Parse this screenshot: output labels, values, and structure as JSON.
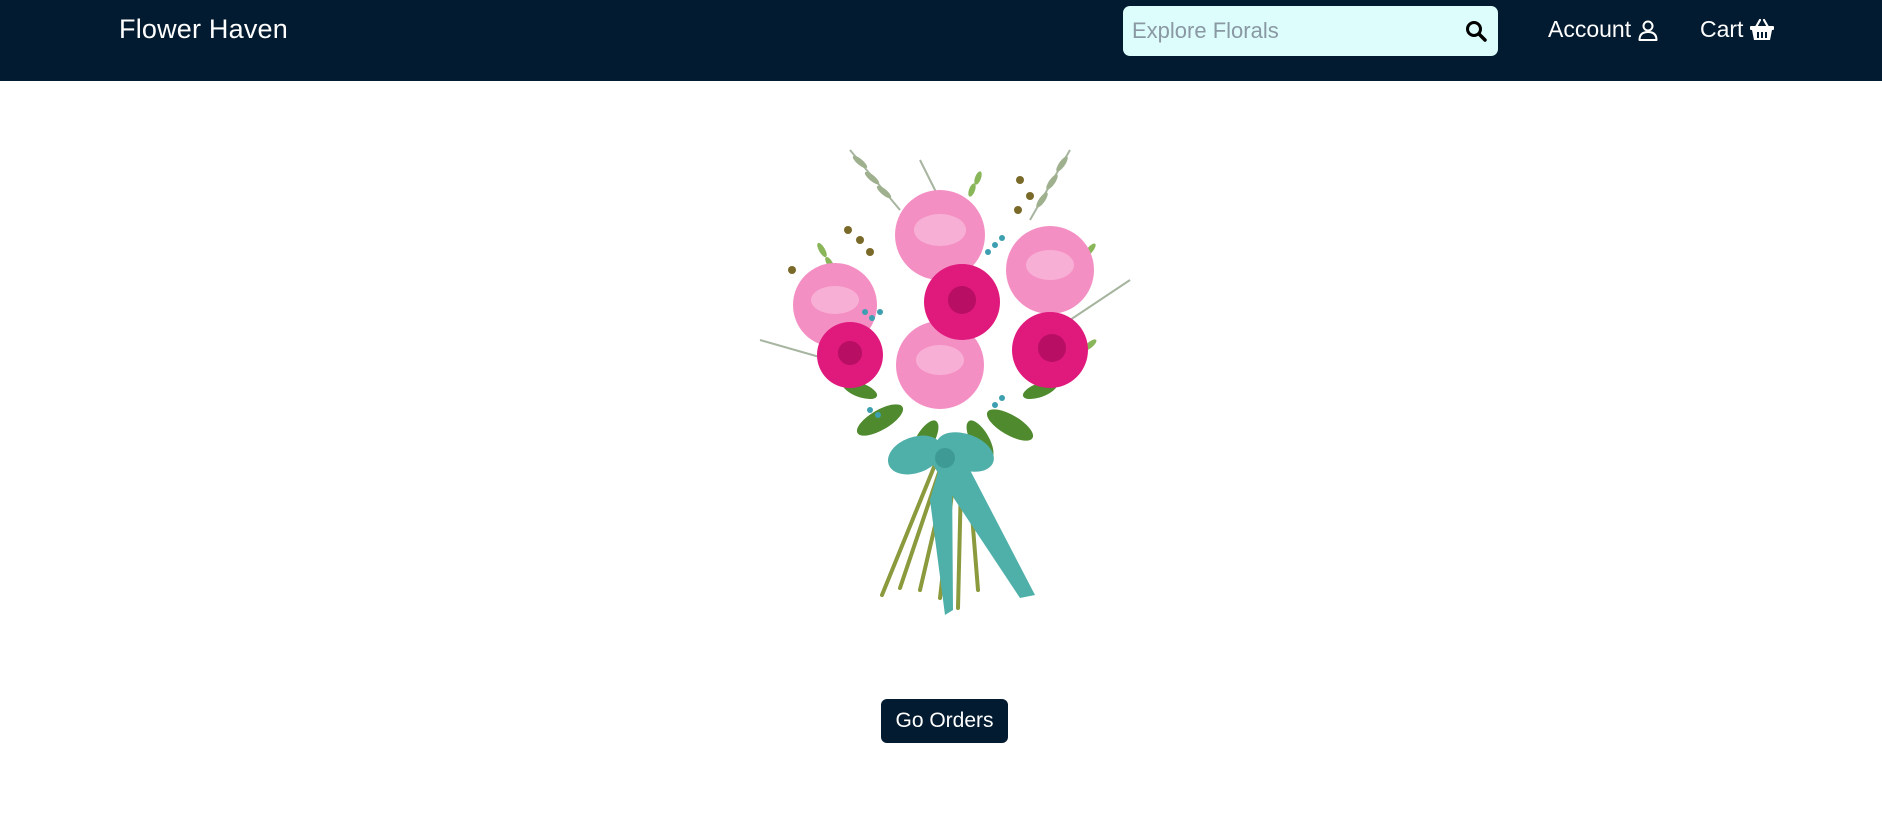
{
  "header": {
    "brand": "Flower Haven",
    "search": {
      "placeholder": "Explore Florals",
      "value": "",
      "icon": "search-icon"
    },
    "account_label": "Account",
    "account_icon": "user-icon",
    "cart_label": "Cart",
    "cart_icon": "basket-icon",
    "background_color": "#021b30",
    "search_background_color": "#dcfdfb"
  },
  "main": {
    "hero_image": "flower-bouquet-illustration",
    "go_orders_label": "Go Orders",
    "button_color": "#021b30"
  }
}
